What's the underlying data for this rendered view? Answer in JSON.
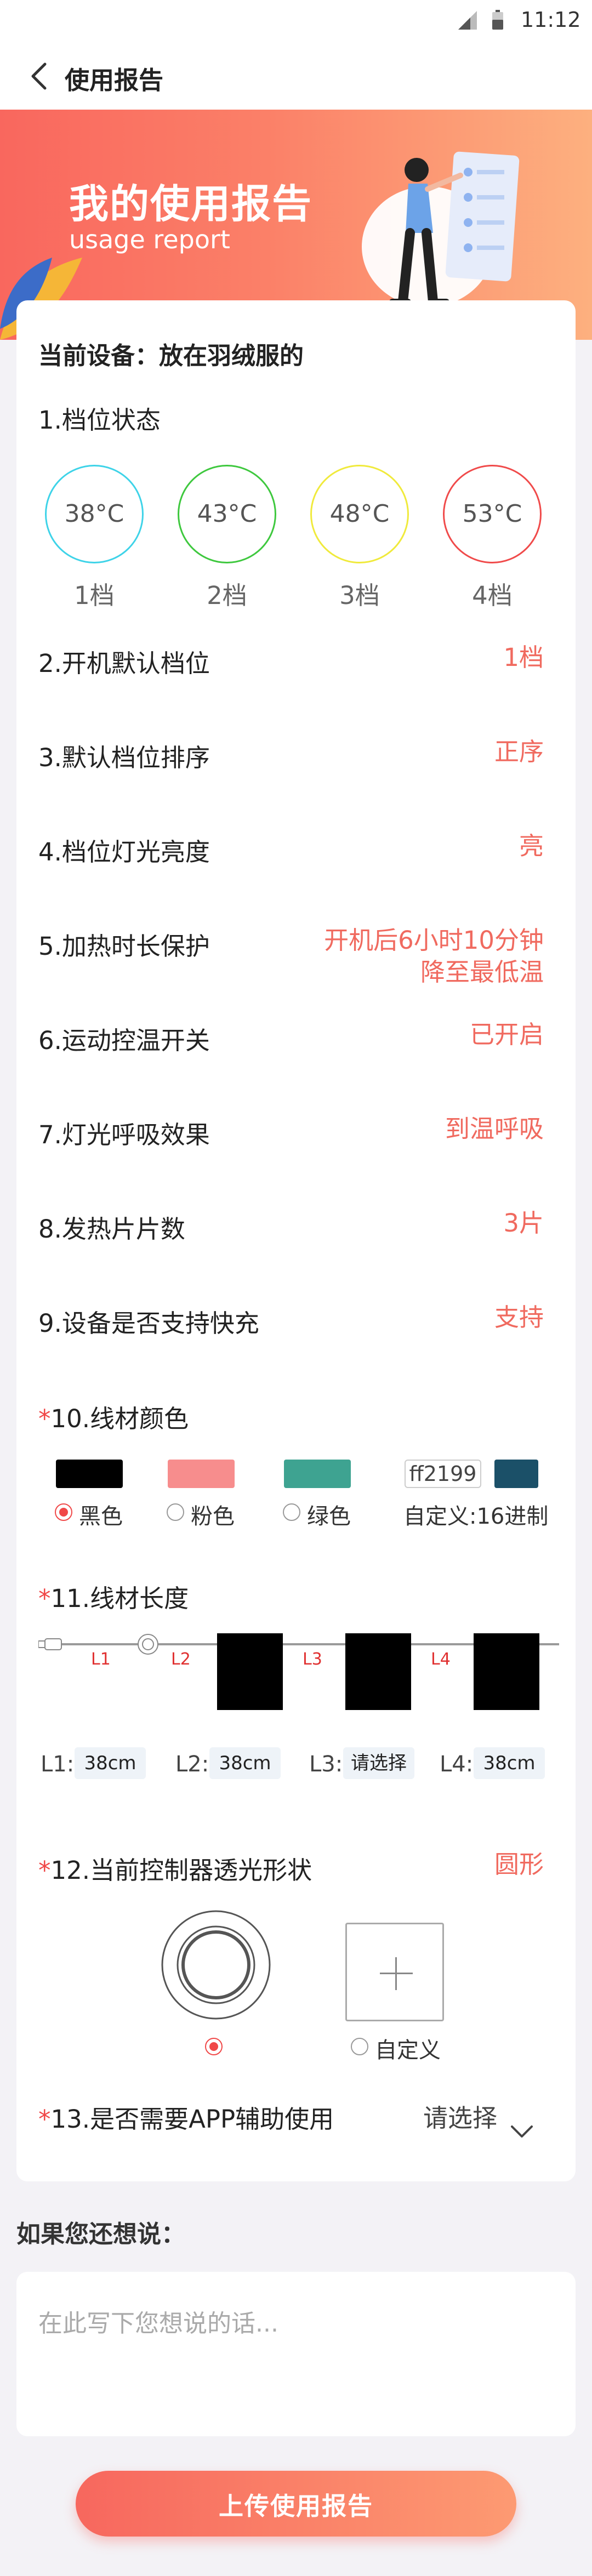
{
  "status_bar": {
    "time": "11:12",
    "icons": [
      "signal-icon",
      "battery-icon"
    ]
  },
  "nav": {
    "title": "使用报告",
    "back_icon": "chevron-left-icon"
  },
  "banner": {
    "title": "我的使用报告",
    "subtitle": "usage report"
  },
  "card": {
    "device": "当前设备：放在羽绒服的",
    "gear_section": {
      "label": "1.档位状态",
      "gears": [
        {
          "temp": "38°C",
          "name": "1档",
          "color": "#3ed3e8"
        },
        {
          "temp": "43°C",
          "name": "2档",
          "color": "#3ec83e"
        },
        {
          "temp": "48°C",
          "name": "3档",
          "color": "#f0ea3c"
        },
        {
          "temp": "53°C",
          "name": "4档",
          "color": "#f04a4a"
        }
      ]
    },
    "rows": [
      {
        "label": "2.开机默认档位",
        "value": "1档"
      },
      {
        "label": "3.默认档位排序",
        "value": "正序"
      },
      {
        "label": "4.档位灯光亮度",
        "value": "亮"
      },
      {
        "label": "5.加热时长保护",
        "value": "开机后6小时10分钟",
        "value2": "降至最低温"
      },
      {
        "label": "6.运动控温开关",
        "value": "已开启"
      },
      {
        "label": "7.灯光呼吸效果",
        "value": "到温呼吸"
      },
      {
        "label": "8.发热片片数",
        "value": "3片"
      },
      {
        "label": "9.设备是否支持快充",
        "value": "支持"
      }
    ],
    "cable_color": {
      "required_mark": "*",
      "label": "10.线材颜色",
      "options": [
        {
          "label": "黑色",
          "color": "#000000",
          "selected": true
        },
        {
          "label": "粉色",
          "color": "#f78d8d",
          "selected": false
        },
        {
          "label": "绿色",
          "color": "#3ea391",
          "selected": false
        }
      ],
      "custom": {
        "hex": "ff2199",
        "color": "#1b5068",
        "label": "自定义:16进制"
      }
    },
    "cable_length": {
      "required_mark": "*",
      "label": "11.线材长度",
      "segments": [
        "L1",
        "L2",
        "L3",
        "L4"
      ],
      "fields": [
        {
          "label": "L1:",
          "value": "38cm"
        },
        {
          "label": "L2:",
          "value": "38cm"
        },
        {
          "label": "L3:",
          "value": "请选择"
        },
        {
          "label": "L4:",
          "value": "38cm"
        }
      ]
    },
    "shape": {
      "required_mark": "*",
      "label": "12.当前控制器透光形状",
      "value": "圆形",
      "custom_label": "自定义"
    },
    "app": {
      "required_mark": "*",
      "label": "13.是否需要APP辅助使用",
      "value": "请选择"
    }
  },
  "feedback": {
    "title": "如果您还想说：",
    "placeholder": "在此写下您想说的话..."
  },
  "submit_label": "上传使用报告"
}
